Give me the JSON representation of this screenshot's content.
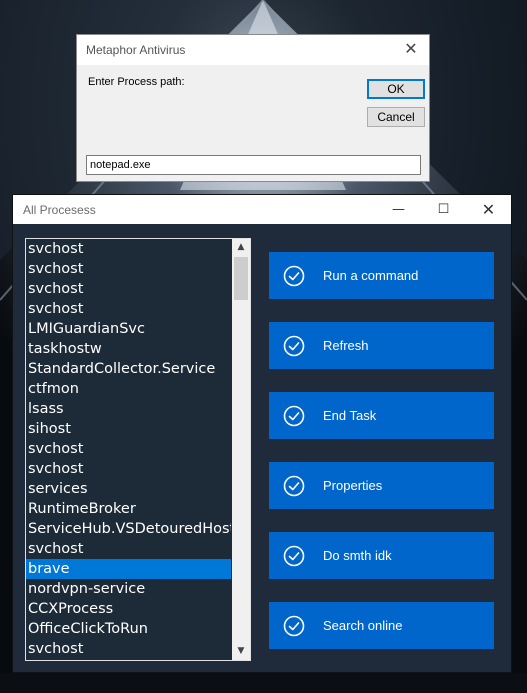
{
  "dialog": {
    "title": "Metaphor Antivirus",
    "prompt": "Enter Process path:",
    "ok_label": "OK",
    "cancel_label": "Cancel",
    "input_value": "notepad.exe"
  },
  "window": {
    "title": "All Procesess",
    "processes": [
      "svchost",
      "svchost",
      "svchost",
      "svchost",
      "LMIGuardianSvc",
      "taskhostw",
      "StandardCollector.Service",
      "ctfmon",
      "lsass",
      "sihost",
      "svchost",
      "svchost",
      "services",
      "RuntimeBroker",
      "ServiceHub.VSDetouredHost",
      "svchost",
      "brave",
      "nordvpn-service",
      "CCXProcess",
      "OfficeClickToRun",
      "svchost"
    ],
    "selected_process": "brave",
    "actions": [
      {
        "label": "Run a command",
        "icon": "check-circle-icon"
      },
      {
        "label": "Refresh",
        "icon": "check-circle-icon"
      },
      {
        "label": "End Task",
        "icon": "check-circle-icon"
      },
      {
        "label": "Properties",
        "icon": "check-circle-icon"
      },
      {
        "label": "Do smth idk",
        "icon": "check-circle-icon"
      },
      {
        "label": "Search online",
        "icon": "check-circle-icon"
      }
    ]
  },
  "colors": {
    "accent": "#0066cc",
    "selection": "#0078d7",
    "window_bg": "#1f2a3a"
  }
}
